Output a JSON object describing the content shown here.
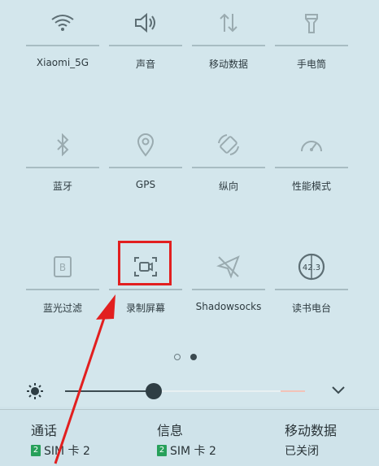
{
  "tiles": [
    {
      "label": "Xiaomi_5G",
      "icon": "wifi-icon"
    },
    {
      "label": "声音",
      "icon": "speaker-icon"
    },
    {
      "label": "移动数据",
      "icon": "mobile-data-icon"
    },
    {
      "label": "手电筒",
      "icon": "flashlight-icon"
    },
    {
      "label": "蓝牙",
      "icon": "bluetooth-icon"
    },
    {
      "label": "GPS",
      "icon": "location-icon"
    },
    {
      "label": "纵向",
      "icon": "rotation-lock-icon"
    },
    {
      "label": "性能模式",
      "icon": "speedometer-icon"
    },
    {
      "label": "蓝光过滤",
      "icon": "blue-light-filter-icon"
    },
    {
      "label": "录制屏幕",
      "icon": "screen-record-icon"
    },
    {
      "label": "Shadowsocks",
      "icon": "paper-plane-icon"
    },
    {
      "label": "读书电台",
      "icon": "reading-radio-icon"
    }
  ],
  "filter_icon_letter": "B",
  "radio_icon_text": "42.3",
  "brightness": {
    "level": 0.35
  },
  "bottom": {
    "calls": {
      "title": "通话",
      "sim_num": "2",
      "sim": "SIM 卡 2"
    },
    "messages": {
      "title": "信息",
      "sim_num": "2",
      "sim": "SIM 卡 2"
    },
    "data": {
      "title": "移动数据",
      "status": "已关闭"
    }
  },
  "colors": {
    "highlight": "#e21f1f",
    "sim_badge": "#27a05a",
    "background": "#d3e6ec"
  }
}
